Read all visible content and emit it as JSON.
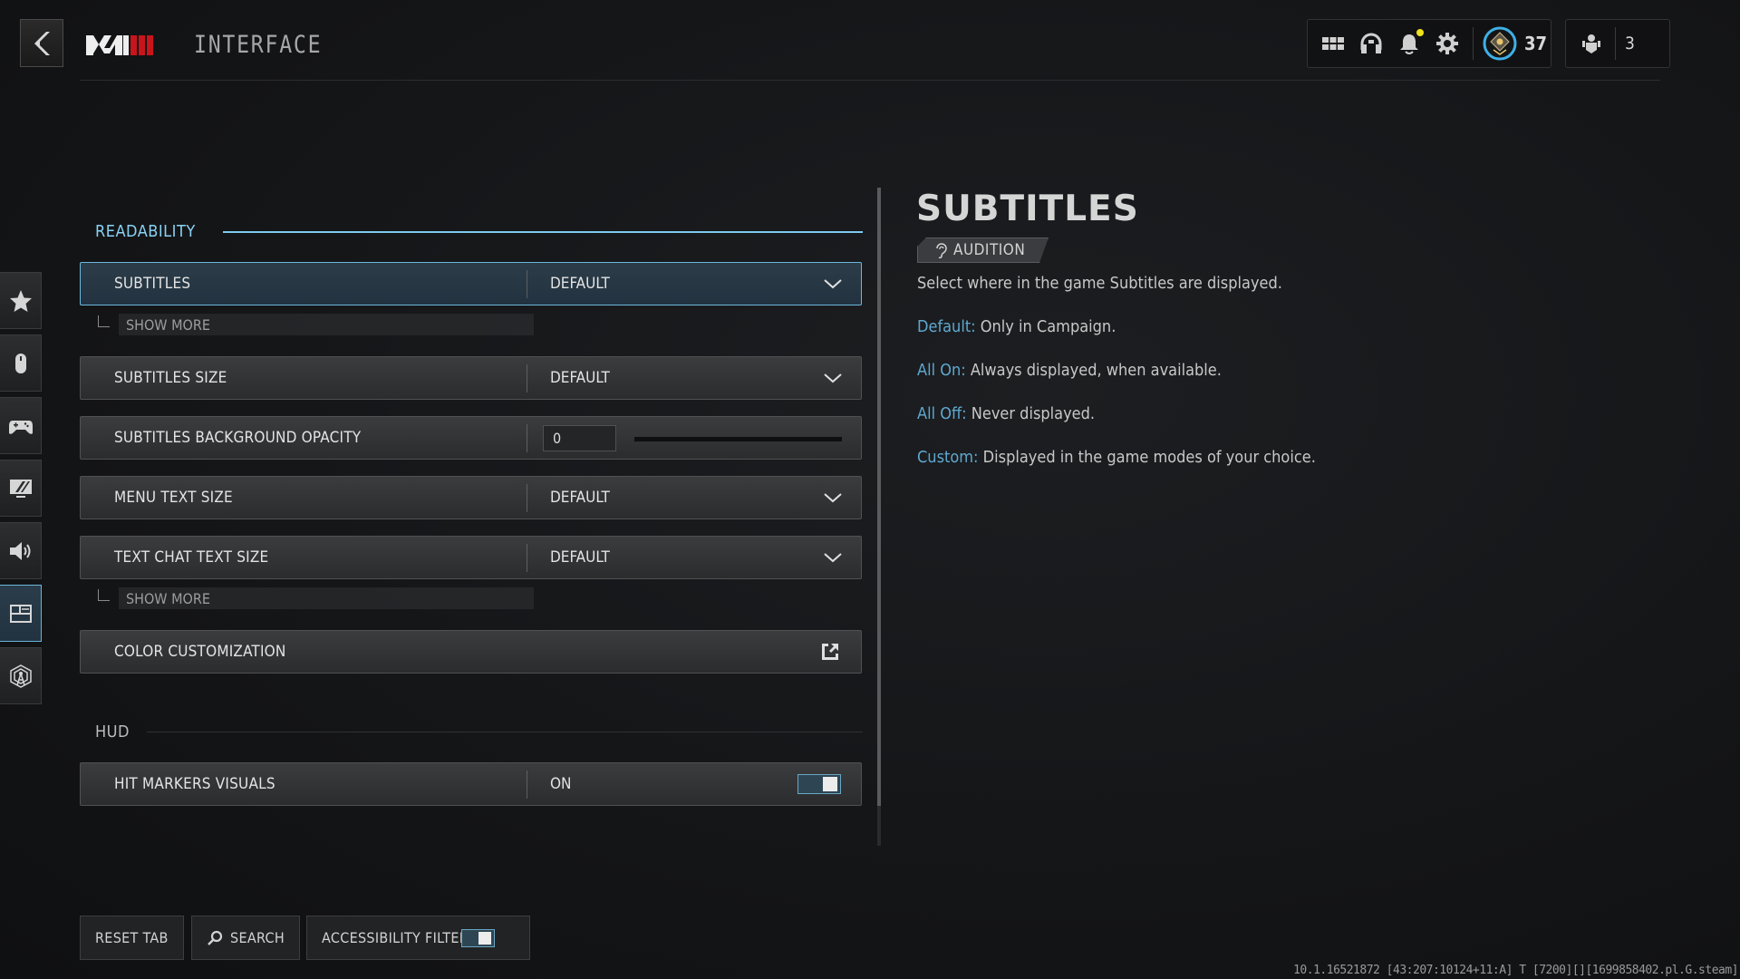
{
  "header": {
    "back_label": "Back",
    "logo_text": "MWIII",
    "title": "INTERFACE",
    "icons": [
      "grid-menu-icon",
      "headset-icon",
      "bell-icon",
      "gear-icon"
    ],
    "rank": "37",
    "party_count": "3",
    "notification_dot_color": "#f0e21b"
  },
  "nav": {
    "items": [
      {
        "icon": "star-icon",
        "label": "Favorites",
        "active": false
      },
      {
        "icon": "mouse-icon",
        "label": "Mouse",
        "active": false
      },
      {
        "icon": "controller-icon",
        "label": "Controller",
        "active": false
      },
      {
        "icon": "display-icon",
        "label": "Graphics",
        "active": false
      },
      {
        "icon": "speaker-icon",
        "label": "Audio",
        "active": false
      },
      {
        "icon": "interface-icon",
        "label": "Interface",
        "active": true
      },
      {
        "icon": "network-icon",
        "label": "Network",
        "active": false
      }
    ]
  },
  "settings": {
    "sections": [
      {
        "title": "READABILITY",
        "rows": [
          {
            "label": "SUBTITLES",
            "type": "dropdown",
            "value": "DEFAULT",
            "selected": true,
            "show_more": "SHOW MORE"
          },
          {
            "label": "SUBTITLES SIZE",
            "type": "dropdown",
            "value": "DEFAULT"
          },
          {
            "label": "SUBTITLES BACKGROUND OPACITY",
            "type": "slider",
            "value": "0",
            "slider_fraction": 0
          },
          {
            "label": "MENU TEXT SIZE",
            "type": "dropdown",
            "value": "DEFAULT"
          },
          {
            "label": "TEXT CHAT TEXT SIZE",
            "type": "dropdown",
            "value": "DEFAULT",
            "show_more": "SHOW MORE"
          },
          {
            "label": "COLOR CUSTOMIZATION",
            "type": "link"
          }
        ]
      },
      {
        "title": "HUD",
        "rows": [
          {
            "label": "HIT MARKERS VISUALS",
            "type": "toggle",
            "value": "ON",
            "on": true
          }
        ]
      }
    ]
  },
  "detail": {
    "title": "SUBTITLES",
    "tag": "AUDITION",
    "description": "Select where in the game Subtitles are displayed.",
    "options": [
      {
        "key": "Default:",
        "text": "Only in Campaign."
      },
      {
        "key": "All On:",
        "text": "Always displayed, when available."
      },
      {
        "key": "All Off:",
        "text": "Never displayed."
      },
      {
        "key": "Custom:",
        "text": "Displayed in the game modes of your choice."
      }
    ]
  },
  "footer": {
    "reset_label": "RESET TAB",
    "search_label": "SEARCH",
    "accessibility_label": "ACCESSIBILITY FILTER",
    "accessibility_on": true,
    "build_string": "10.1.16521872 [43:207:10124+11:A] T [7200][][1699858402.pl.G.steam]"
  },
  "colors": {
    "accent": "#7ccbef",
    "key_text": "#5fa8cf",
    "logo_red": "#c8141b"
  }
}
